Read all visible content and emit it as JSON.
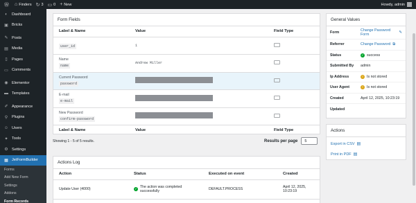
{
  "adminbar": {
    "site_name": "Finders",
    "updates_count": "3",
    "comments_count": "0",
    "new_label": "New",
    "greeting": "Howdy, admin"
  },
  "sidebar": {
    "items": [
      {
        "label": "Dashboard",
        "icon": "dashboard-icon",
        "glyph": "◐"
      },
      {
        "label": "Bricks",
        "icon": "bricks-icon",
        "glyph": "▣"
      },
      {
        "label": "Posts",
        "icon": "pin-icon",
        "glyph": "✎"
      },
      {
        "label": "Media",
        "icon": "media-icon",
        "glyph": "▤"
      },
      {
        "label": "Pages",
        "icon": "pages-icon",
        "glyph": "▯"
      },
      {
        "label": "Comments",
        "icon": "comment-icon",
        "glyph": "▭"
      },
      {
        "label": "Elementor",
        "icon": "elementor-icon",
        "glyph": "◉"
      },
      {
        "label": "Templates",
        "icon": "folder-icon",
        "glyph": "▬"
      },
      {
        "label": "Appearance",
        "icon": "brush-icon",
        "glyph": "✐"
      },
      {
        "label": "Plugins",
        "icon": "plugin-icon",
        "glyph": "⚲"
      },
      {
        "label": "Users",
        "icon": "user-icon",
        "glyph": "☺"
      },
      {
        "label": "Tools",
        "icon": "wrench-icon",
        "glyph": "✦"
      },
      {
        "label": "Settings",
        "icon": "settings-icon",
        "glyph": "⚙"
      },
      {
        "label": "JetFormBuilder",
        "icon": "jetformbuilder-icon",
        "glyph": "▦"
      }
    ],
    "submenu": [
      "Forms",
      "Add New Form",
      "Settings",
      "Addons",
      "Form Records"
    ]
  },
  "form_fields": {
    "title": "Form Fields",
    "headers": [
      "Label & Name",
      "Value",
      "Field Type"
    ],
    "rows": [
      {
        "label": "",
        "name": "user_id",
        "value": "1",
        "masked": false
      },
      {
        "label": "Name",
        "name": "name",
        "value": "Andrew Miller",
        "masked": false
      },
      {
        "label": "Current Password",
        "name": "password",
        "value": "",
        "masked": true
      },
      {
        "label": "E-mail",
        "name": "e-mail",
        "value": "",
        "masked": true
      },
      {
        "label": "New Password",
        "name": "confirm-password",
        "value": "",
        "masked": true
      }
    ]
  },
  "pagination": {
    "showing": "Showing 1 - 5 of 5 results.",
    "results_per_page_label": "Results per page",
    "results_per_page_value": "5"
  },
  "actions_log": {
    "title": "Actions Log",
    "headers": [
      "Action",
      "Status",
      "Executed on event",
      "Created"
    ],
    "rows": [
      {
        "action": "Update User (4000)",
        "status": "The action was completed successfully",
        "event": "DEFAULT.PROCESS",
        "created": "April 12, 2025, 10:23:19"
      }
    ]
  },
  "general_values": {
    "title": "General Values",
    "form_label": "Form",
    "form_value": "Change Password Form",
    "referrer_label": "Referrer",
    "referrer_value": "Change Password",
    "status_label": "Status",
    "status_value": "success",
    "submitted_by_label": "Submitted By",
    "submitted_by_value": "admin",
    "ip_label": "Ip Address",
    "ip_value": "Is not stored",
    "ua_label": "User Agent",
    "ua_value": "Is not stored",
    "created_label": "Created",
    "created_value": "April 12, 2025, 10:23:19",
    "updated_label": "Updated",
    "updated_value": ""
  },
  "actions_box": {
    "title": "Actions",
    "export_csv": "Export in CSV",
    "print_pdf": "Print in PDF"
  },
  "colors": {
    "adminbar_bg": "#1d2327",
    "active_menu": "#2271b1",
    "link": "#2271b1",
    "success": "#00a32a",
    "warning": "#dba617",
    "highlight_row": "#e8f4fb"
  }
}
